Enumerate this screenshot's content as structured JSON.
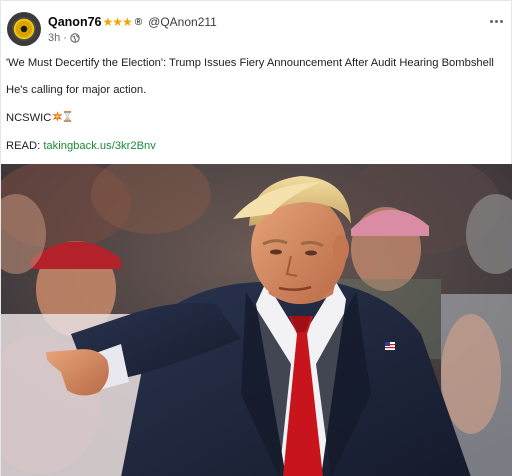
{
  "post": {
    "author": "Qanon76",
    "stars": "★★★",
    "registered": "®",
    "handle": "@QAnon211",
    "time": "3h",
    "separator": "·",
    "audience_icon": "globe-icon",
    "more_icon": "more-options-icon",
    "headline": "'We Must Decertify the Election': Trump Issues Fiery Announcement After Audit Hearing Bombshell",
    "line2": "He's calling for major action.",
    "line3": "NCSWIC",
    "read_label": "READ:",
    "read_link": "takingback.us/3kr2Bnv"
  },
  "colors": {
    "link": "#1b8a3a",
    "stars": "#f0a500",
    "suit": "#1c2438",
    "tie": "#c8141c",
    "hair": "#e2c88a"
  }
}
